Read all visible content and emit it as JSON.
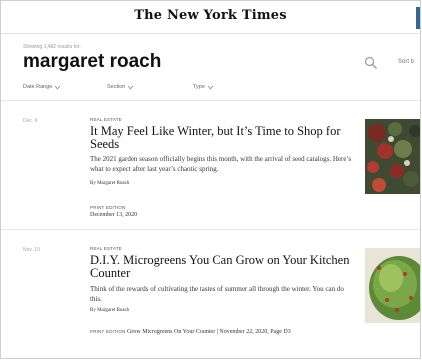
{
  "masthead": {
    "logo": "The New York Times"
  },
  "search": {
    "results_count_text": "Showing 1,482 results for:",
    "query": "margaret roach",
    "sort_label": "Sort b"
  },
  "filters": [
    {
      "label": "Date Range"
    },
    {
      "label": "Section"
    },
    {
      "label": "Type"
    }
  ],
  "results": [
    {
      "date": "Dec. 9",
      "section": "REAL ESTATE",
      "headline": "It May Feel Like Winter, but It’s Time to Shop for Seeds",
      "summary": "The 2021 garden season officially begins this month, with the arrival of seed catalogs. Here’s what to expect after last year’s chaotic spring.",
      "byline": "By Margaret Roach",
      "edition_label": "PRINT EDITION",
      "edition_date": "December 13, 2020"
    },
    {
      "date": "Nov. 19",
      "section": "REAL ESTATE",
      "headline": "D.I.Y. Microgreens You Can Grow on Your Kitchen Counter",
      "summary": "Think of the rewards of cultivating the tastes of summer all through the winter. You can do this.",
      "byline": "By Margaret Roach",
      "edition_label": "PRINT EDITION",
      "edition_text": "Grow Microgreens On Your Counter | November 22, 2020, Page D3"
    }
  ],
  "colors": {
    "accent": "#326891",
    "text": "#121212",
    "muted": "#999999"
  }
}
